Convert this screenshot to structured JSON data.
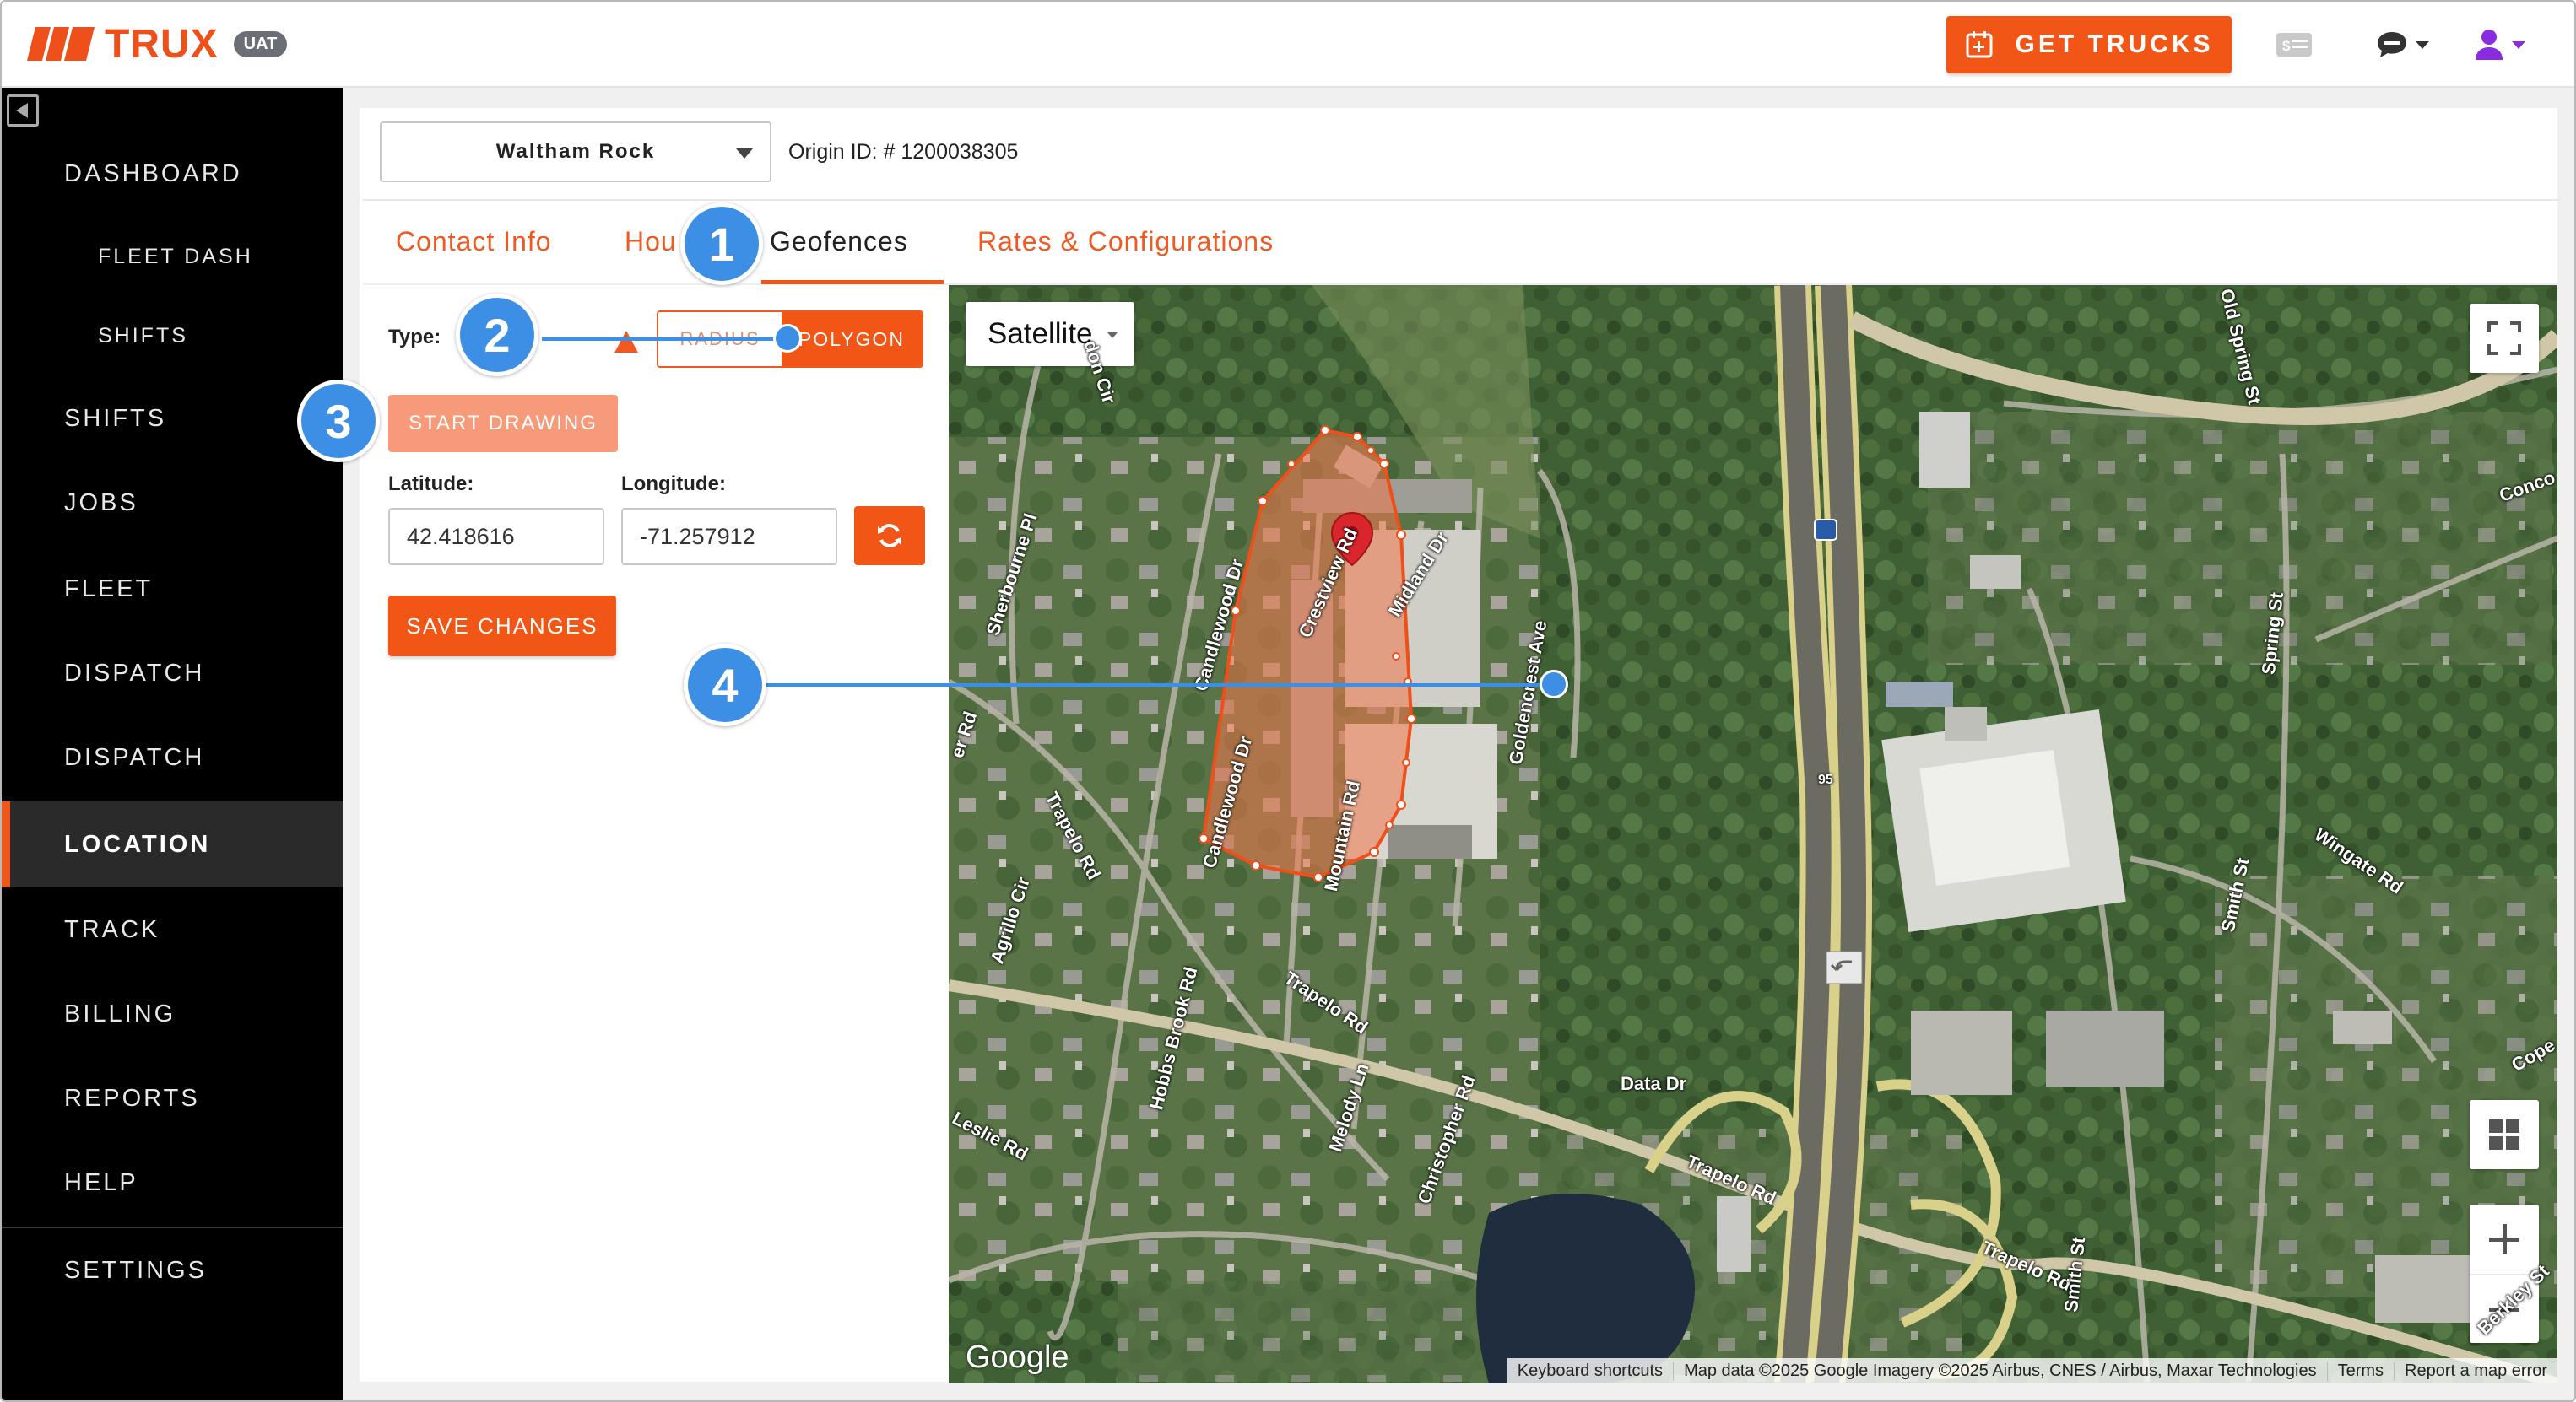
{
  "brand": {
    "name": "TRUX",
    "env_badge": "UAT",
    "accent": "#f25617"
  },
  "header": {
    "get_trucks_label": "GET TRUCKS"
  },
  "sidebar": {
    "items": [
      {
        "label": "DASHBOARD"
      },
      {
        "label": "FLEET DASH"
      },
      {
        "label": "SHIFTS"
      },
      {
        "label": "SHIFTS"
      },
      {
        "label": "JOBS"
      },
      {
        "label": "FLEET"
      },
      {
        "label": "DISPATCH"
      },
      {
        "label": "DISPATCH"
      },
      {
        "label": "LOCATION"
      },
      {
        "label": "TRACK"
      },
      {
        "label": "BILLING"
      },
      {
        "label": "REPORTS"
      },
      {
        "label": "HELP"
      },
      {
        "label": "SETTINGS"
      }
    ],
    "active": "LOCATION"
  },
  "location": {
    "selected": "Waltham Rock",
    "origin_id": "Origin ID: # 1200038305"
  },
  "tabs": [
    {
      "label": "Contact Info"
    },
    {
      "label": "Hou"
    },
    {
      "label": "Geofences"
    },
    {
      "label": "Rates & Configurations"
    }
  ],
  "geofence": {
    "type_label": "Type:",
    "radius_label": "RADIUS",
    "polygon_label": "POLYGON",
    "start_drawing_label": "START DRAWING",
    "latitude_label": "Latitude:",
    "longitude_label": "Longitude:",
    "latitude": "42.418616",
    "longitude": "-71.257912",
    "save_label": "SAVE CHANGES"
  },
  "map": {
    "type_label": "Satellite",
    "google_label": "Google",
    "attribution": [
      "Keyboard shortcuts",
      "Map data ©2025 Google Imagery ©2025 Airbus, CNES / Airbus, Maxar Technologies",
      "Terms",
      "Report a map error"
    ],
    "streets": [
      "don Cir",
      "Sherbourne Pl",
      "Candlewood Dr",
      "Crestview Rd",
      "Midland Dr",
      "Goldencrest Ave",
      "Candlewood Dr",
      "Mountain Rd",
      "Trapelo Rd",
      "Agrillo Cir",
      "Hobbs Brook Rd",
      "Leslie Rd",
      "Trapelo Rd",
      "Melody Ln",
      "Christopher Rd",
      "Data Dr",
      "Trapelo Rd",
      "Trapelo Rd",
      "Smith St",
      "Smith St",
      "Spring St",
      "Wingate Rd",
      "Old Spring St",
      "Conco",
      "Cope",
      "Berkley St",
      "er Rd",
      "95"
    ]
  },
  "callouts": [
    "1",
    "2",
    "3",
    "4"
  ]
}
